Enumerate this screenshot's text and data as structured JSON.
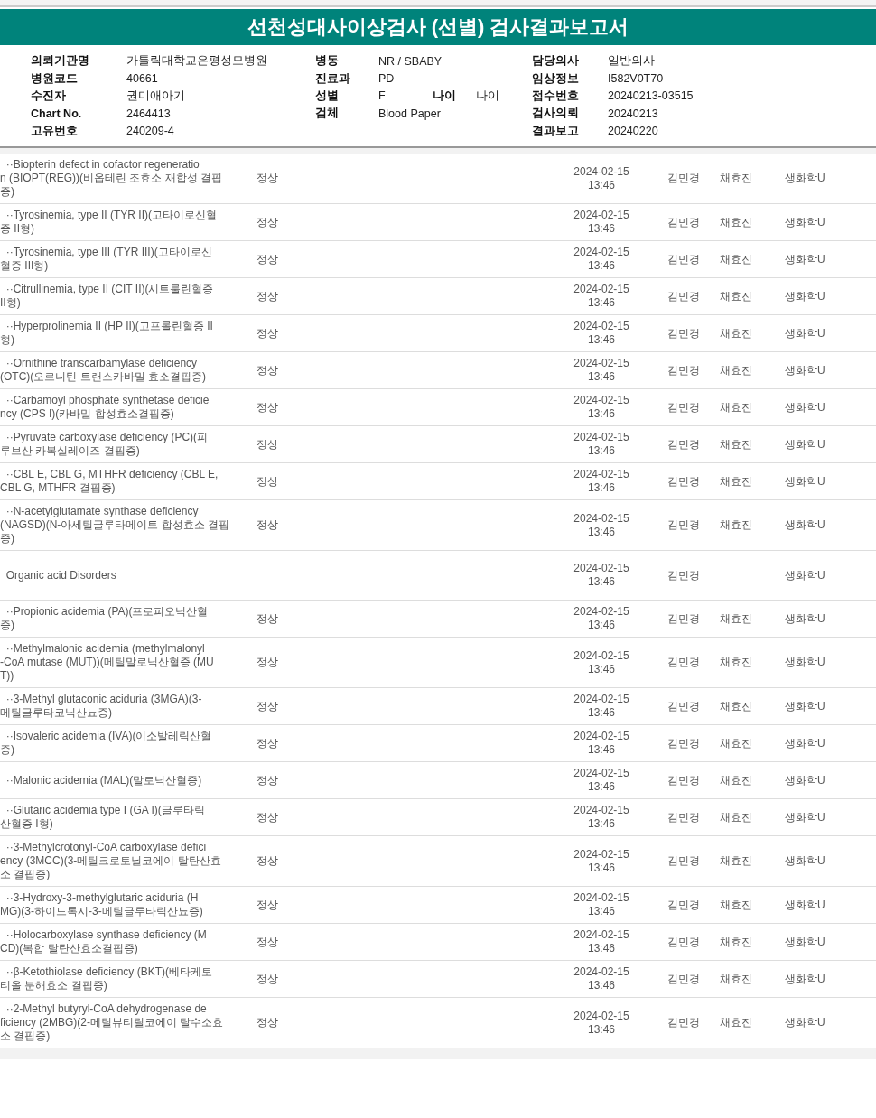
{
  "title": "선천성대사이상검사 (선별) 검사결과보고서",
  "info_columns": [
    {
      "items": [
        {
          "label": "의뢰기관명",
          "value": "가톨릭대학교은평성모병원"
        },
        {
          "label": "병원코드",
          "value": "40661"
        },
        {
          "label": "수진자",
          "value": "권미애아기"
        },
        {
          "label": "Chart No.",
          "value": "2464413"
        },
        {
          "label": "고유번호",
          "value": "240209-4"
        }
      ]
    },
    {
      "items": [
        {
          "label": "병동",
          "value": "NR / SBABY"
        },
        {
          "label": "진료과",
          "value": "PD"
        },
        {
          "label": "성별",
          "value": "F",
          "extra_label": "나이",
          "extra_value": "나이"
        },
        {
          "label": "검체",
          "value": "Blood Paper"
        }
      ]
    },
    {
      "items": [
        {
          "label": "담당의사",
          "value": "일반의사"
        },
        {
          "label": "임상정보",
          "value": "I582V0T70"
        },
        {
          "label": "접수번호",
          "value": "20240213-03515"
        },
        {
          "label": "검사의뢰",
          "value": "20240213"
        },
        {
          "label": "결과보고",
          "value": "20240220"
        }
      ]
    }
  ],
  "rows": [
    {
      "kind": "test",
      "name": "  ··Biopterin defect in cofactor regeneratio\nn (BIOPT(REG))(비옵테린 조효소 재합성 결핍\n증)",
      "result": "정상",
      "datetime": "2024-02-15\n13:46",
      "person_1": "김민경",
      "person_2": "채효진",
      "department": "생화학U"
    },
    {
      "kind": "test",
      "name": "  ··Tyrosinemia, type II (TYR II)(고타이로신혈\n증 II형)",
      "result": "정상",
      "datetime": "2024-02-15\n13:46",
      "person_1": "김민경",
      "person_2": "채효진",
      "department": "생화학U"
    },
    {
      "kind": "test",
      "name": "  ··Tyrosinemia, type III (TYR III)(고타이로신\n혈증 III형)",
      "result": "정상",
      "datetime": "2024-02-15\n13:46",
      "person_1": "김민경",
      "person_2": "채효진",
      "department": "생화학U"
    },
    {
      "kind": "test",
      "name": "  ··Citrullinemia, type II (CIT II)(시트룰린혈증\nII형)",
      "result": "정상",
      "datetime": "2024-02-15\n13:46",
      "person_1": "김민경",
      "person_2": "채효진",
      "department": "생화학U"
    },
    {
      "kind": "test",
      "name": "  ··Hyperprolinemia II (HP II)(고프롤린혈증 II\n형)",
      "result": "정상",
      "datetime": "2024-02-15\n13:46",
      "person_1": "김민경",
      "person_2": "채효진",
      "department": "생화학U"
    },
    {
      "kind": "test",
      "name": "  ··Ornithine transcarbamylase deficiency\n(OTC)(오르니틴 트랜스카바밀 효소결핍증)",
      "result": "정상",
      "datetime": "2024-02-15\n13:46",
      "person_1": "김민경",
      "person_2": "채효진",
      "department": "생화학U"
    },
    {
      "kind": "test",
      "name": "  ··Carbamoyl phosphate synthetase deficie\nncy (CPS I)(카바밀 합성효소결핍증)",
      "result": "정상",
      "datetime": "2024-02-15\n13:46",
      "person_1": "김민경",
      "person_2": "채효진",
      "department": "생화학U"
    },
    {
      "kind": "test",
      "name": "  ··Pyruvate carboxylase deficiency (PC)(피\n루브산 카복실레이즈 결핍증)",
      "result": "정상",
      "datetime": "2024-02-15\n13:46",
      "person_1": "김민경",
      "person_2": "채효진",
      "department": "생화학U"
    },
    {
      "kind": "test",
      "name": "  ··CBL E, CBL G, MTHFR deficiency (CBL E,\nCBL G, MTHFR 결핍증)",
      "result": "정상",
      "datetime": "2024-02-15\n13:46",
      "person_1": "김민경",
      "person_2": "채효진",
      "department": "생화학U"
    },
    {
      "kind": "test",
      "name": "  ··N-acetylglutamate synthase deficiency\n(NAGSD)(N-아세틸글루타메이트 합성효소 결핍\n증)",
      "result": "정상",
      "datetime": "2024-02-15\n13:46",
      "person_1": "김민경",
      "person_2": "채효진",
      "department": "생화학U"
    },
    {
      "kind": "group",
      "name": "  Organic acid Disorders",
      "datetime": "2024-02-15\n13:46",
      "person_1": "김민경",
      "department": "생화학U"
    },
    {
      "kind": "test",
      "name": "  ··Propionic acidemia (PA)(프로피오닉산혈\n증)",
      "result": "정상",
      "datetime": "2024-02-15\n13:46",
      "person_1": "김민경",
      "person_2": "채효진",
      "department": "생화학U"
    },
    {
      "kind": "test",
      "name": "  ··Methylmalonic acidemia (methylmalonyl\n-CoA mutase (MUT))(메틸말로닉산혈증 (MU\nT))",
      "result": "정상",
      "datetime": "2024-02-15\n13:46",
      "person_1": "김민경",
      "person_2": "채효진",
      "department": "생화학U"
    },
    {
      "kind": "test",
      "name": "  ··3-Methyl glutaconic aciduria (3MGA)(3-\n메틸글루타코닉산뇨증)",
      "result": "정상",
      "datetime": "2024-02-15\n13:46",
      "person_1": "김민경",
      "person_2": "채효진",
      "department": "생화학U"
    },
    {
      "kind": "test",
      "name": "  ··Isovaleric acidemia (IVA)(이소발레릭산혈\n증)",
      "result": "정상",
      "datetime": "2024-02-15\n13:46",
      "person_1": "김민경",
      "person_2": "채효진",
      "department": "생화학U"
    },
    {
      "kind": "test",
      "name": "  ··Malonic acidemia (MAL)(말로닉산혈증)",
      "result": "정상",
      "datetime": "2024-02-15\n13:46",
      "person_1": "김민경",
      "person_2": "채효진",
      "department": "생화학U"
    },
    {
      "kind": "test",
      "name": "  ··Glutaric acidemia type I (GA I)(글루타릭\n산혈증 I형)",
      "result": "정상",
      "datetime": "2024-02-15\n13:46",
      "person_1": "김민경",
      "person_2": "채효진",
      "department": "생화학U"
    },
    {
      "kind": "test",
      "name": "  ··3-Methylcrotonyl-CoA carboxylase defici\nency (3MCC)(3-메틸크로토닐코에이 탈탄산효\n소 결핍증)",
      "result": "정상",
      "datetime": "2024-02-15\n13:46",
      "person_1": "김민경",
      "person_2": "채효진",
      "department": "생화학U"
    },
    {
      "kind": "test",
      "name": "  ··3-Hydroxy-3-methylglutaric aciduria (H\nMG)(3-하이드록시-3-메틸글루타릭산뇨증)",
      "result": "정상",
      "datetime": "2024-02-15\n13:46",
      "person_1": "김민경",
      "person_2": "채효진",
      "department": "생화학U"
    },
    {
      "kind": "test",
      "name": "  ··Holocarboxylase synthase deficiency (M\nCD)(복합 탈탄산효소결핍증)",
      "result": "정상",
      "datetime": "2024-02-15\n13:46",
      "person_1": "김민경",
      "person_2": "채효진",
      "department": "생화학U"
    },
    {
      "kind": "test",
      "name": "  ··β-Ketothiolase deficiency (BKT)(베타케토\n티올 분해효소 결핍증)",
      "result": "정상",
      "datetime": "2024-02-15\n13:46",
      "person_1": "김민경",
      "person_2": "채효진",
      "department": "생화학U"
    },
    {
      "kind": "test",
      "name": "  ··2-Methyl butyryl-CoA dehydrogenase de\nficiency (2MBG)(2-메틸뷰티릴코에이 탈수소효\n소 결핍증)",
      "result": "정상",
      "datetime": "2024-02-15\n13:46",
      "person_1": "김민경",
      "person_2": "채효진",
      "department": "생화학U"
    }
  ]
}
